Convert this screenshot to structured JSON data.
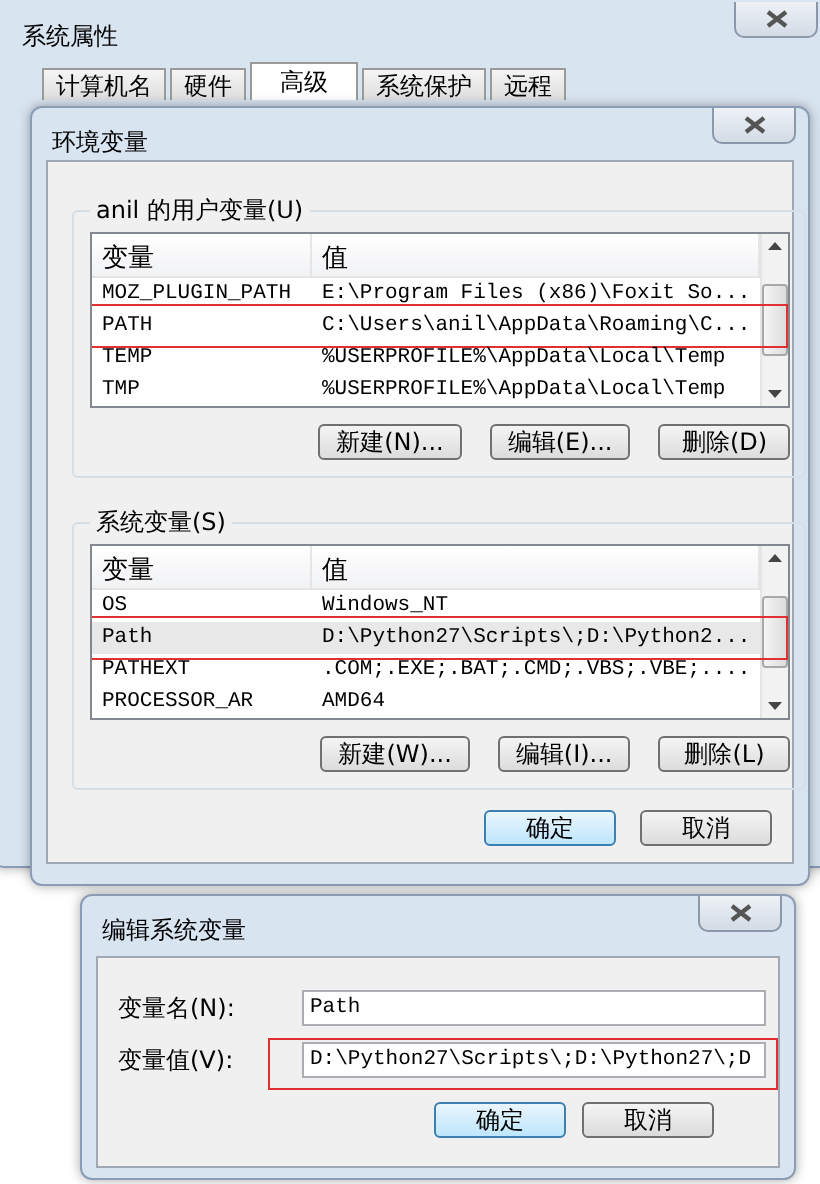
{
  "outer_window": {
    "title": "系统属性",
    "tabs": [
      {
        "label": "计算机名",
        "selected": false
      },
      {
        "label": "硬件",
        "selected": false
      },
      {
        "label": "高级",
        "selected": true
      },
      {
        "label": "系统保护",
        "selected": false
      },
      {
        "label": "远程",
        "selected": false
      }
    ]
  },
  "env_window": {
    "title": "环境变量",
    "groups": [
      {
        "label": "anil 的用户变量(U)",
        "columns": [
          "变量",
          "值"
        ],
        "rows": [
          {
            "name": "MOZ_PLUGIN_PATH",
            "value": "E:\\Program Files (x86)\\Foxit So...",
            "selected": false,
            "highlighted": false
          },
          {
            "name": "PATH",
            "value": "C:\\Users\\anil\\AppData\\Roaming\\C...",
            "selected": false,
            "highlighted": true
          },
          {
            "name": "TEMP",
            "value": "%USERPROFILE%\\AppData\\Local\\Temp",
            "selected": false,
            "highlighted": false
          },
          {
            "name": "TMP",
            "value": "%USERPROFILE%\\AppData\\Local\\Temp",
            "selected": false,
            "highlighted": false
          }
        ],
        "buttons": [
          "新建(N)...",
          "编辑(E)...",
          "删除(D)"
        ]
      },
      {
        "label": "系统变量(S)",
        "columns": [
          "变量",
          "值"
        ],
        "rows": [
          {
            "name": "OS",
            "value": "Windows_NT",
            "selected": false,
            "highlighted": false
          },
          {
            "name": "Path",
            "value": "D:\\Python27\\Scripts\\;D:\\Python2...",
            "selected": true,
            "highlighted": true
          },
          {
            "name": "PATHEXT",
            "value": ".COM;.EXE;.BAT;.CMD;.VBS;.VBE;....",
            "selected": false,
            "highlighted": false
          },
          {
            "name": "PROCESSOR_AR",
            "value": "AMD64",
            "selected": false,
            "highlighted": false
          }
        ],
        "buttons": [
          "新建(W)...",
          "编辑(I)...",
          "删除(L)"
        ]
      }
    ],
    "buttons": [
      "确定",
      "取消"
    ]
  },
  "edit_dialog": {
    "title": "编辑系统变量",
    "fields": [
      {
        "label": "变量名(N):",
        "value": "Path",
        "highlighted": false
      },
      {
        "label": "变量值(V):",
        "value": "D:\\Python27\\Scripts\\;D:\\Python27\\;D",
        "highlighted": true
      }
    ],
    "buttons": [
      "确定",
      "取消"
    ]
  }
}
